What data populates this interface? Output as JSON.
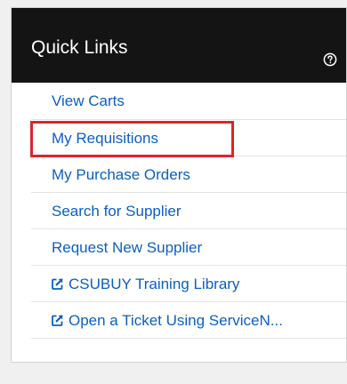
{
  "panel": {
    "title": "Quick Links",
    "help_icon": "question-circle-icon"
  },
  "links": [
    {
      "label": "View Carts",
      "external": false
    },
    {
      "label": "My Requisitions",
      "external": false,
      "highlighted": true
    },
    {
      "label": "My Purchase Orders",
      "external": false
    },
    {
      "label": "Search for Supplier",
      "external": false
    },
    {
      "label": "Request New Supplier",
      "external": false
    },
    {
      "label": "CSUBUY Training Library",
      "external": true,
      "icon": "external-link-icon"
    },
    {
      "label": "Open a Ticket Using ServiceN...",
      "external": true,
      "icon": "external-link-icon"
    }
  ],
  "colors": {
    "header_bg": "#141414",
    "link": "#0a5fc4",
    "highlight": "#d9262c"
  }
}
